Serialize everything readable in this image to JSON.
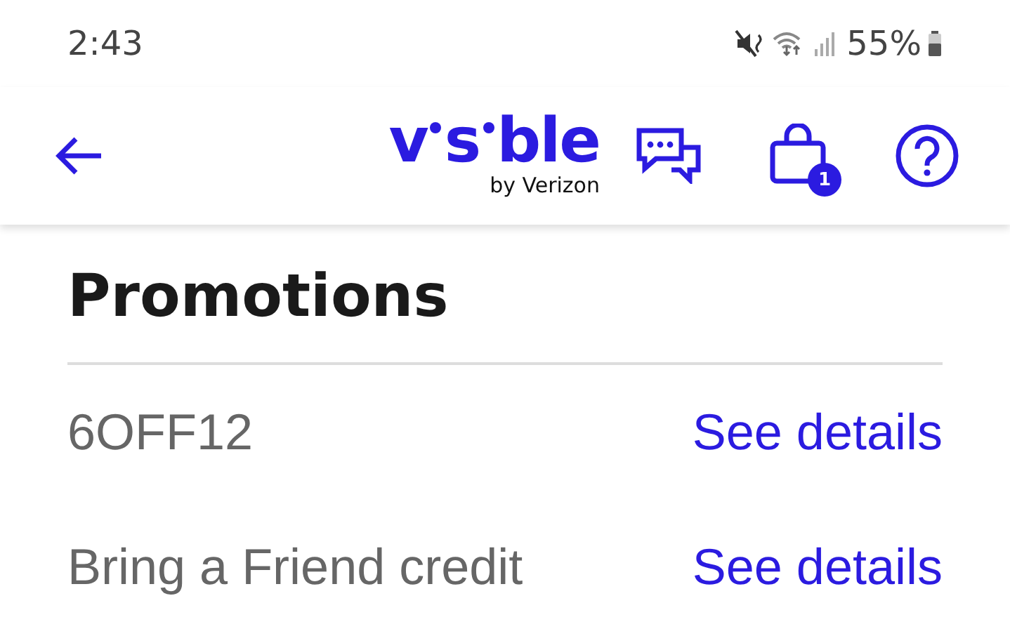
{
  "status_bar": {
    "time": "2:43",
    "battery": "55%"
  },
  "header": {
    "logo": {
      "parts": [
        "v",
        "s",
        "ble"
      ],
      "tagline": "by Verizon"
    },
    "cart_count": "1"
  },
  "title": "Promotions",
  "promotions": [
    {
      "name": "6OFF12",
      "link": "See details"
    },
    {
      "name": "Bring a Friend credit",
      "link": "See details"
    }
  ]
}
